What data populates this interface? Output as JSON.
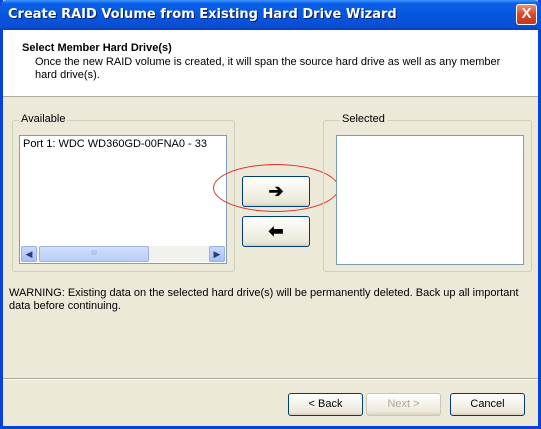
{
  "window": {
    "title": "Create RAID Volume from Existing Hard Drive Wizard",
    "close_label": "X"
  },
  "header": {
    "title": "Select Member Hard Drive(s)",
    "description": "Once the new RAID volume is created, it will span the source hard drive as well as any member hard drive(s)."
  },
  "available": {
    "label": "Available",
    "items": [
      "Port 1: WDC WD360GD-00FNA0 - 33"
    ]
  },
  "selected": {
    "label": "Selected",
    "items": []
  },
  "buttons": {
    "add": "➔",
    "remove": "⬅",
    "back": "< Back",
    "next": "Next >",
    "cancel": "Cancel"
  },
  "scrollbar": {
    "left": "◀",
    "right": "▶",
    "thumb": "III"
  },
  "warning": "WARNING: Existing data on the selected hard drive(s) will be permanently deleted. Back up all important data before continuing."
}
